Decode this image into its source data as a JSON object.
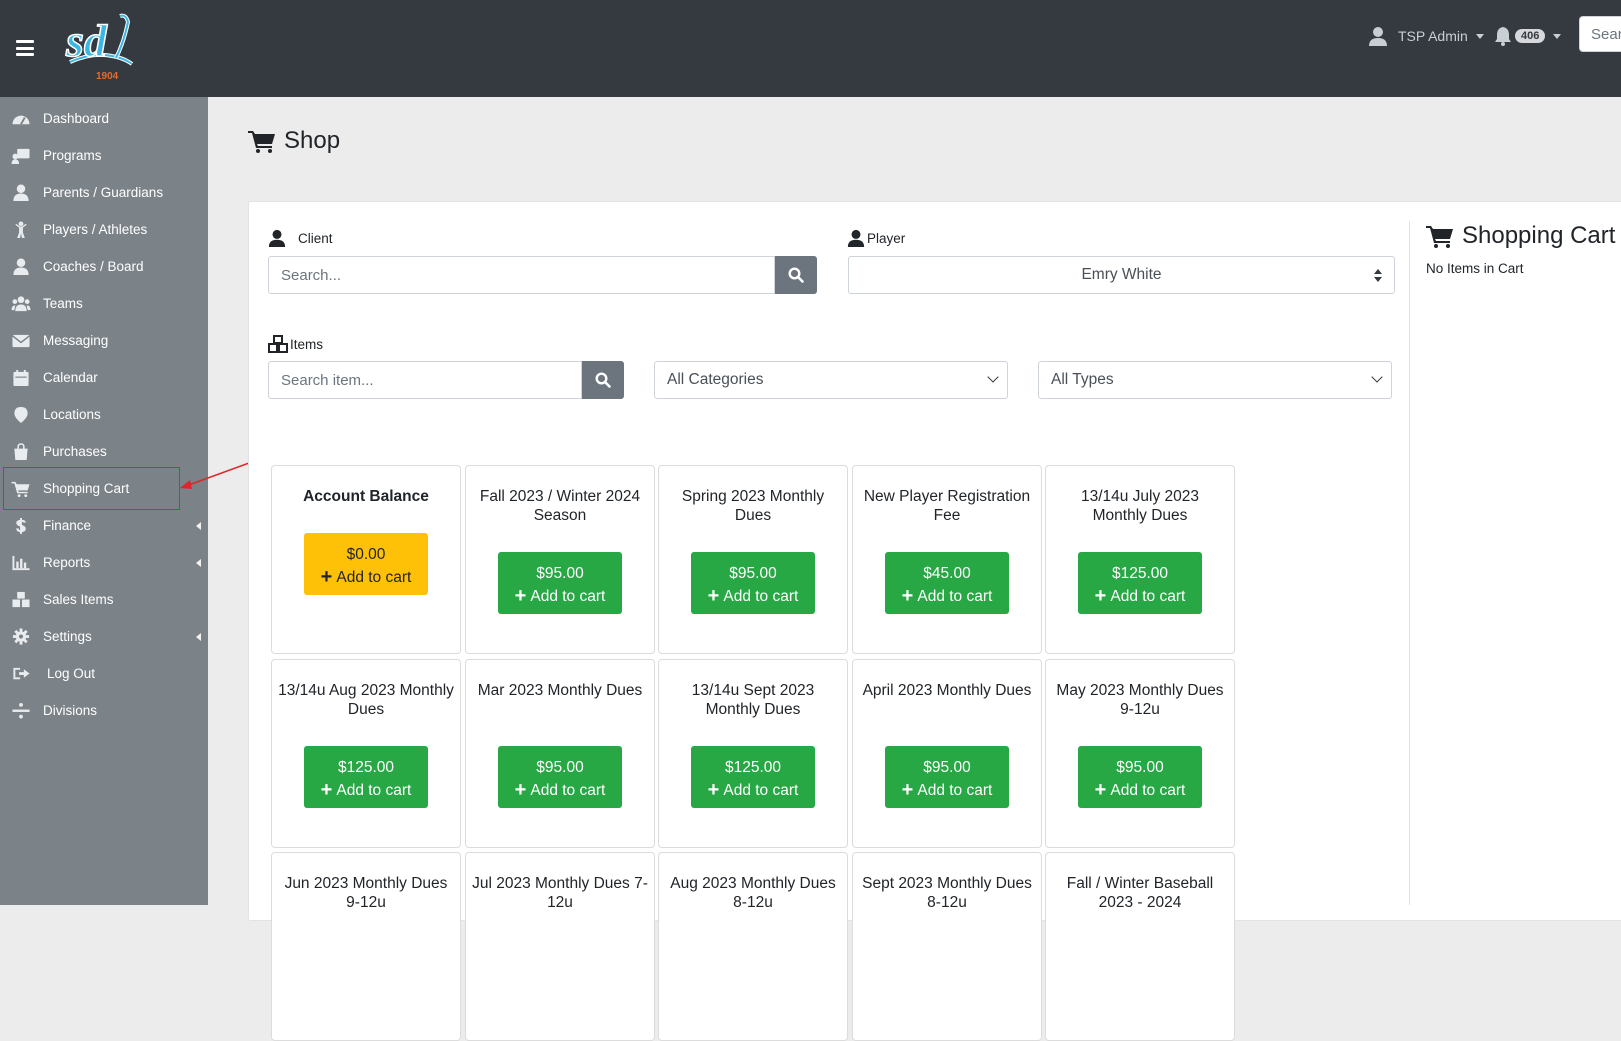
{
  "header": {
    "user_name": "TSP Admin",
    "notification_count": "406",
    "search_placeholder": "Search"
  },
  "sidebar": {
    "items": [
      {
        "label": "Dashboard",
        "icon": "dashboard-icon",
        "expandable": false
      },
      {
        "label": "Programs",
        "icon": "programs-icon",
        "expandable": false
      },
      {
        "label": "Parents / Guardians",
        "icon": "user-icon",
        "expandable": false
      },
      {
        "label": "Players / Athletes",
        "icon": "athlete-icon",
        "expandable": false
      },
      {
        "label": "Coaches / Board",
        "icon": "coach-icon",
        "expandable": false
      },
      {
        "label": "Teams",
        "icon": "users-icon",
        "expandable": false
      },
      {
        "label": "Messaging",
        "icon": "envelope-icon",
        "expandable": false
      },
      {
        "label": "Calendar",
        "icon": "calendar-icon",
        "expandable": false
      },
      {
        "label": "Locations",
        "icon": "map-marker-icon",
        "expandable": false
      },
      {
        "label": "Purchases",
        "icon": "shopping-bag-icon",
        "expandable": false
      },
      {
        "label": "Shopping Cart",
        "icon": "shopping-cart-icon",
        "expandable": false
      },
      {
        "label": "Finance",
        "icon": "dollar-icon",
        "expandable": true
      },
      {
        "label": "Reports",
        "icon": "bar-chart-icon",
        "expandable": true
      },
      {
        "label": "Sales Items",
        "icon": "cubes-icon",
        "expandable": false
      },
      {
        "label": "Settings",
        "icon": "gear-icon",
        "expandable": true
      },
      {
        "label": "Log Out",
        "icon": "sign-out-icon",
        "expandable": false
      },
      {
        "label": "Divisions",
        "icon": "divide-icon",
        "expandable": false
      }
    ]
  },
  "page": {
    "title": "Shop"
  },
  "filters": {
    "client_label": "Client",
    "client_placeholder": "Search...",
    "player_label": "Player",
    "player_value": "Emry White",
    "items_label": "Items",
    "items_placeholder": "Search item...",
    "category_value": "All Categories",
    "type_value": "All Types"
  },
  "cart": {
    "title": "Shopping Cart",
    "empty_text": "No Items in Cart"
  },
  "products": [
    {
      "name": "Account Balance",
      "price": "$0.00",
      "action": "Add to cart",
      "highlight": true
    },
    {
      "name": "Fall 2023 / Winter 2024 Season",
      "price": "$95.00",
      "action": "Add to cart"
    },
    {
      "name": "Spring 2023 Monthly Dues",
      "price": "$95.00",
      "action": "Add to cart"
    },
    {
      "name": "New Player Registration Fee",
      "price": "$45.00",
      "action": "Add to cart"
    },
    {
      "name": "13/14u July 2023 Monthly Dues",
      "price": "$125.00",
      "action": "Add to cart"
    },
    {
      "name": "13/14u Aug 2023 Monthly Dues",
      "price": "$125.00",
      "action": "Add to cart"
    },
    {
      "name": "Mar 2023 Monthly Dues",
      "price": "$95.00",
      "action": "Add to cart"
    },
    {
      "name": "13/14u Sept 2023 Monthly Dues",
      "price": "$125.00",
      "action": "Add to cart"
    },
    {
      "name": "April 2023 Monthly Dues",
      "price": "$95.00",
      "action": "Add to cart"
    },
    {
      "name": "May 2023 Monthly Dues 9-12u",
      "price": "$95.00",
      "action": "Add to cart"
    },
    {
      "name": "Jun 2023 Monthly Dues 9-12u",
      "price": "",
      "action": ""
    },
    {
      "name": "Jul 2023 Monthly Dues 7-12u",
      "price": "",
      "action": ""
    },
    {
      "name": "Aug 2023 Monthly Dues 8-12u",
      "price": "",
      "action": ""
    },
    {
      "name": "Sept 2023 Monthly Dues 8-12u",
      "price": "",
      "action": ""
    },
    {
      "name": "Fall / Winter Baseball 2023 - 2024",
      "price": "",
      "action": ""
    }
  ],
  "colors": {
    "topbar": "#343a40",
    "sidebar": "#7b8288",
    "add_button": "#28a745",
    "balance_button": "#ffc107",
    "annotation": "#e0252a"
  }
}
